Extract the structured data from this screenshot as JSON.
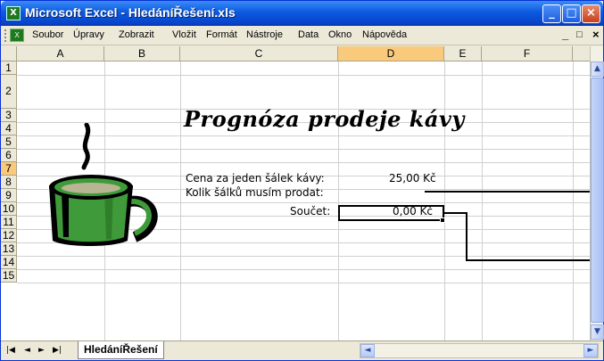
{
  "window": {
    "title": "Microsoft Excel - HledáníŘešení.xls",
    "title_icon": "excel-icon"
  },
  "menubar": {
    "items": [
      "Soubor",
      "Úpravy",
      "Zobrazit",
      "Vložit",
      "Formát",
      "Nástroje",
      "Data",
      "Okno",
      "Nápověda"
    ],
    "right_min": "_",
    "right_restore": "🗗",
    "right_close": "×"
  },
  "grid": {
    "columns": [
      "A",
      "B",
      "C",
      "D",
      "E",
      "F"
    ],
    "rows": [
      "1",
      "2",
      "3",
      "4",
      "5",
      "6",
      "7",
      "8",
      "9",
      "10",
      "11",
      "12",
      "13",
      "14",
      "15"
    ],
    "active_column": "D",
    "active_row": "7"
  },
  "sheet": {
    "headline": "Prognóza prodeje kávy",
    "cena_label": "Cena za jeden šálek kávy:",
    "cena_value": "25,00 Kč",
    "kolik_label": "Kolik šálků musím prodat:",
    "soucet_label": "Součet:",
    "soucet_value": "0,00 Kč"
  },
  "tabs": {
    "sheet_name": "HledáníŘešení",
    "nav_first": "◄",
    "nav_prev": "◄",
    "nav_next": "►",
    "nav_last": "►"
  },
  "colors": {
    "titlebar": "#0a5ae0",
    "active_header": "#f9c97c",
    "cup_green": "#3f9a3a"
  }
}
